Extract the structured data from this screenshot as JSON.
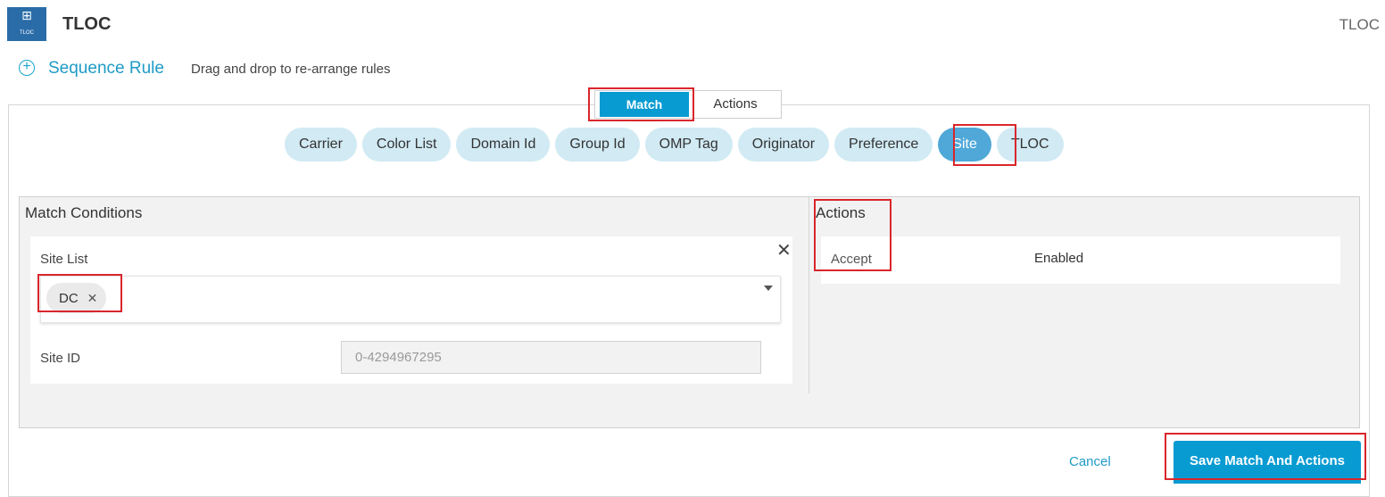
{
  "header": {
    "title": "TLOC",
    "icon_caption": "TLOC",
    "top_right_label": "TLOC"
  },
  "sequence": {
    "label": "Sequence Rule",
    "hint": "Drag and drop to re-arrange rules"
  },
  "toggle": {
    "match_label": "Match",
    "actions_label": "Actions",
    "selected": "Match"
  },
  "match_types": [
    {
      "label": "Carrier",
      "active": false
    },
    {
      "label": "Color List",
      "active": false
    },
    {
      "label": "Domain Id",
      "active": false
    },
    {
      "label": "Group Id",
      "active": false
    },
    {
      "label": "OMP Tag",
      "active": false
    },
    {
      "label": "Originator",
      "active": false
    },
    {
      "label": "Preference",
      "active": false
    },
    {
      "label": "Site",
      "active": true
    },
    {
      "label": "TLOC",
      "active": false
    }
  ],
  "match_conditions": {
    "title": "Match Conditions",
    "site_list_label": "Site List",
    "site_list_tags": [
      {
        "label": "DC"
      }
    ],
    "site_id_label": "Site ID",
    "site_id_placeholder": "0-4294967295",
    "site_id_value": ""
  },
  "actions_panel": {
    "title": "Actions",
    "accept_label": "Accept",
    "accept_value": "Enabled"
  },
  "footer": {
    "cancel_label": "Cancel",
    "save_label": "Save Match And Actions"
  },
  "colors": {
    "accent": "#079bd2",
    "chip_bg": "#d1eaf4",
    "chip_active": "#4fa8d8",
    "highlight": "#d9262c"
  }
}
